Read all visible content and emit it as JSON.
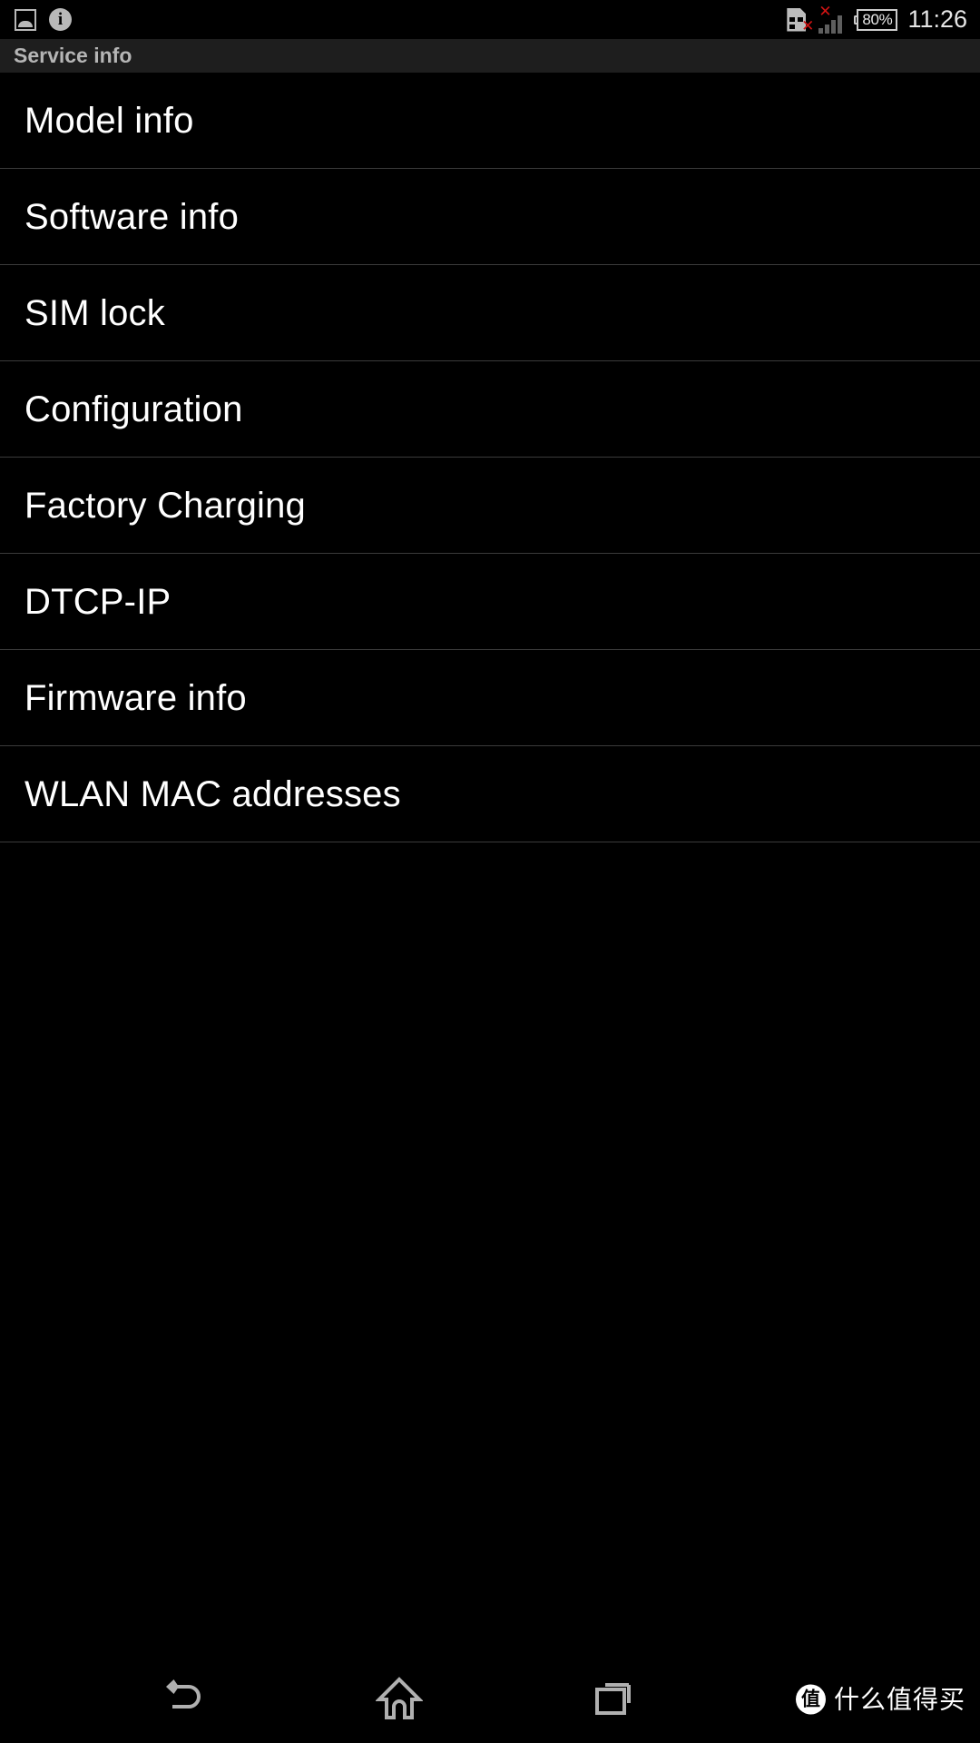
{
  "status_bar": {
    "left_icons": [
      {
        "name": "screenshot-icon",
        "glyph": "image"
      },
      {
        "name": "info-icon",
        "glyph": "i"
      }
    ],
    "info_glyph": "i",
    "sim": {
      "name": "sim-card-error-icon",
      "error_mark": "✕"
    },
    "signal": {
      "name": "signal-error-icon",
      "error_mark": "✕",
      "bars": 4
    },
    "battery": {
      "name": "battery-icon",
      "level": "80%"
    },
    "clock": "11:26"
  },
  "title_bar": {
    "title": "Service info"
  },
  "list": {
    "items": [
      {
        "label": "Model info"
      },
      {
        "label": "Software info"
      },
      {
        "label": "SIM lock"
      },
      {
        "label": "Configuration"
      },
      {
        "label": "Factory Charging"
      },
      {
        "label": "DTCP-IP"
      },
      {
        "label": "Firmware info"
      },
      {
        "label": "WLAN MAC addresses"
      }
    ]
  },
  "nav_bar": {
    "back": "back-icon",
    "home": "home-icon",
    "recents": "recents-icon"
  },
  "watermark": {
    "logo": "值",
    "text": "什么值得买"
  },
  "colors": {
    "background": "#000000",
    "title_bar": "#1e1e1e",
    "title_text": "#b5b5b5",
    "item_text": "#ffffff",
    "divider": "#3b3b3b",
    "status_text": "#e6e6e6",
    "error_red": "#d01313",
    "nav_icon": "#b0b0b0"
  }
}
